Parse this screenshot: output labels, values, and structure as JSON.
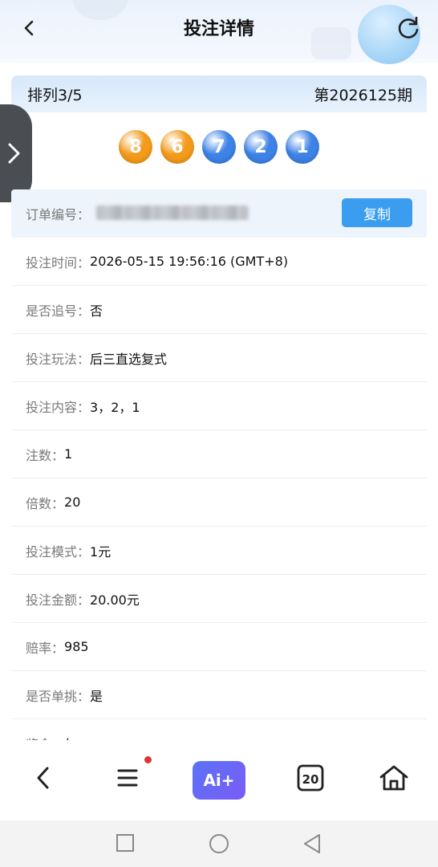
{
  "header": {
    "title": "投注详情",
    "back_icon": "chevron-left-icon",
    "refresh_icon": "refresh-icon"
  },
  "period": {
    "name": "排列3/5",
    "issue": "第2026125期"
  },
  "balls": [
    {
      "number": "8",
      "color": "#f39a1a"
    },
    {
      "number": "6",
      "color": "#f39a1a"
    },
    {
      "number": "7",
      "color": "#3d82e6"
    },
    {
      "number": "2",
      "color": "#3d82e6"
    },
    {
      "number": "1",
      "color": "#3d82e6"
    }
  ],
  "order": {
    "label": "订单编号：",
    "copy_label": "复制"
  },
  "details": [
    {
      "k": "投注时间：",
      "v": "2026-05-15 19:56:16 (GMT+8)"
    },
    {
      "k": "是否追号：",
      "v": "否"
    },
    {
      "k": "投注玩法：",
      "v": "后三直选复式"
    },
    {
      "k": "投注内容：",
      "v": "3，2，1"
    },
    {
      "k": "注数：",
      "v": "1"
    },
    {
      "k": "倍数：",
      "v": "20"
    },
    {
      "k": "投注模式：",
      "v": "1元"
    },
    {
      "k": "投注金额：",
      "v": "20.00元"
    },
    {
      "k": "赔率：",
      "v": "985"
    },
    {
      "k": "是否单挑：",
      "v": "是"
    },
    {
      "k": "奖金：",
      "v": "/"
    }
  ],
  "bottom_nav": {
    "ai_label": "Ai+",
    "badge_label": "20",
    "items": [
      "back-icon",
      "menu-icon",
      "ai-assistant-icon",
      "calendar-20-icon",
      "home-icon"
    ]
  },
  "colors": {
    "accent": "#3a9df0",
    "orange_ball": "#f39a1a",
    "blue_ball": "#3d82e6"
  }
}
